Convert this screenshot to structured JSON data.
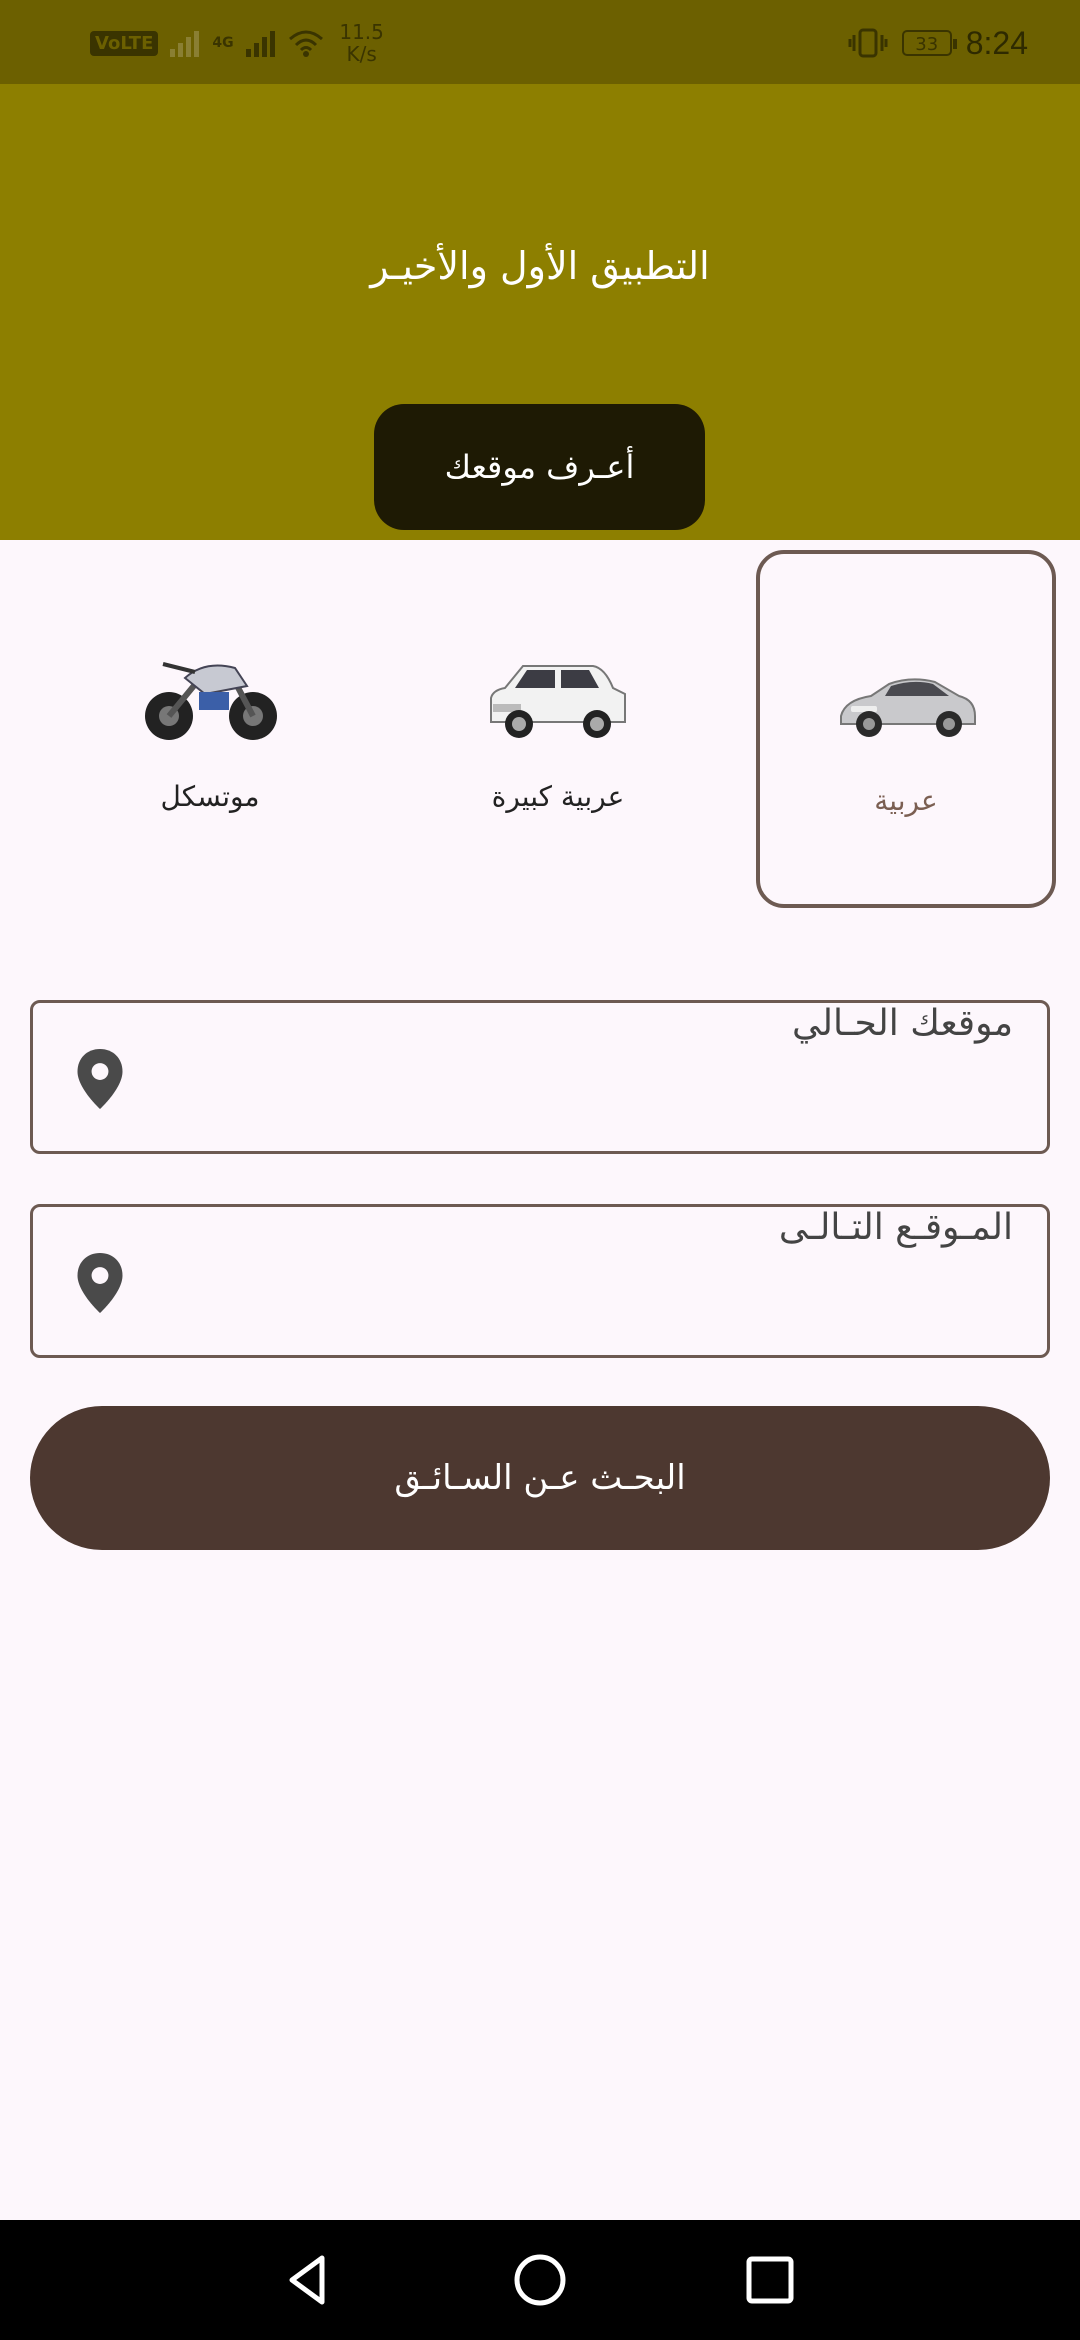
{
  "status_bar": {
    "network_badge": "VoLTE",
    "network_type": "4G",
    "speed_value": "11.5",
    "speed_unit": "K/s",
    "battery": "33",
    "time": "8:24"
  },
  "header": {
    "title": "التطبيق الأول والأخيـر",
    "locate_button": "أعـرف موقعك"
  },
  "vehicles": [
    {
      "label": "عربية",
      "icon": "sports-car-icon",
      "selected": true
    },
    {
      "label": "عربية كبيرة",
      "icon": "suv-icon",
      "selected": false
    },
    {
      "label": "موتسكل",
      "icon": "motorcycle-icon",
      "selected": false
    }
  ],
  "form": {
    "current_location": "موقعك الحـالي",
    "next_location": "المـوقـع التـالـى",
    "search_button": "البحـث عـن السـائـق"
  },
  "colors": {
    "header": "#8d7f00",
    "status_bar": "#6c6000",
    "accent": "#4d3830",
    "border": "#6d5a52",
    "background": "#fdf7fc"
  },
  "nav": [
    "back-icon",
    "home-icon",
    "recents-icon"
  ]
}
